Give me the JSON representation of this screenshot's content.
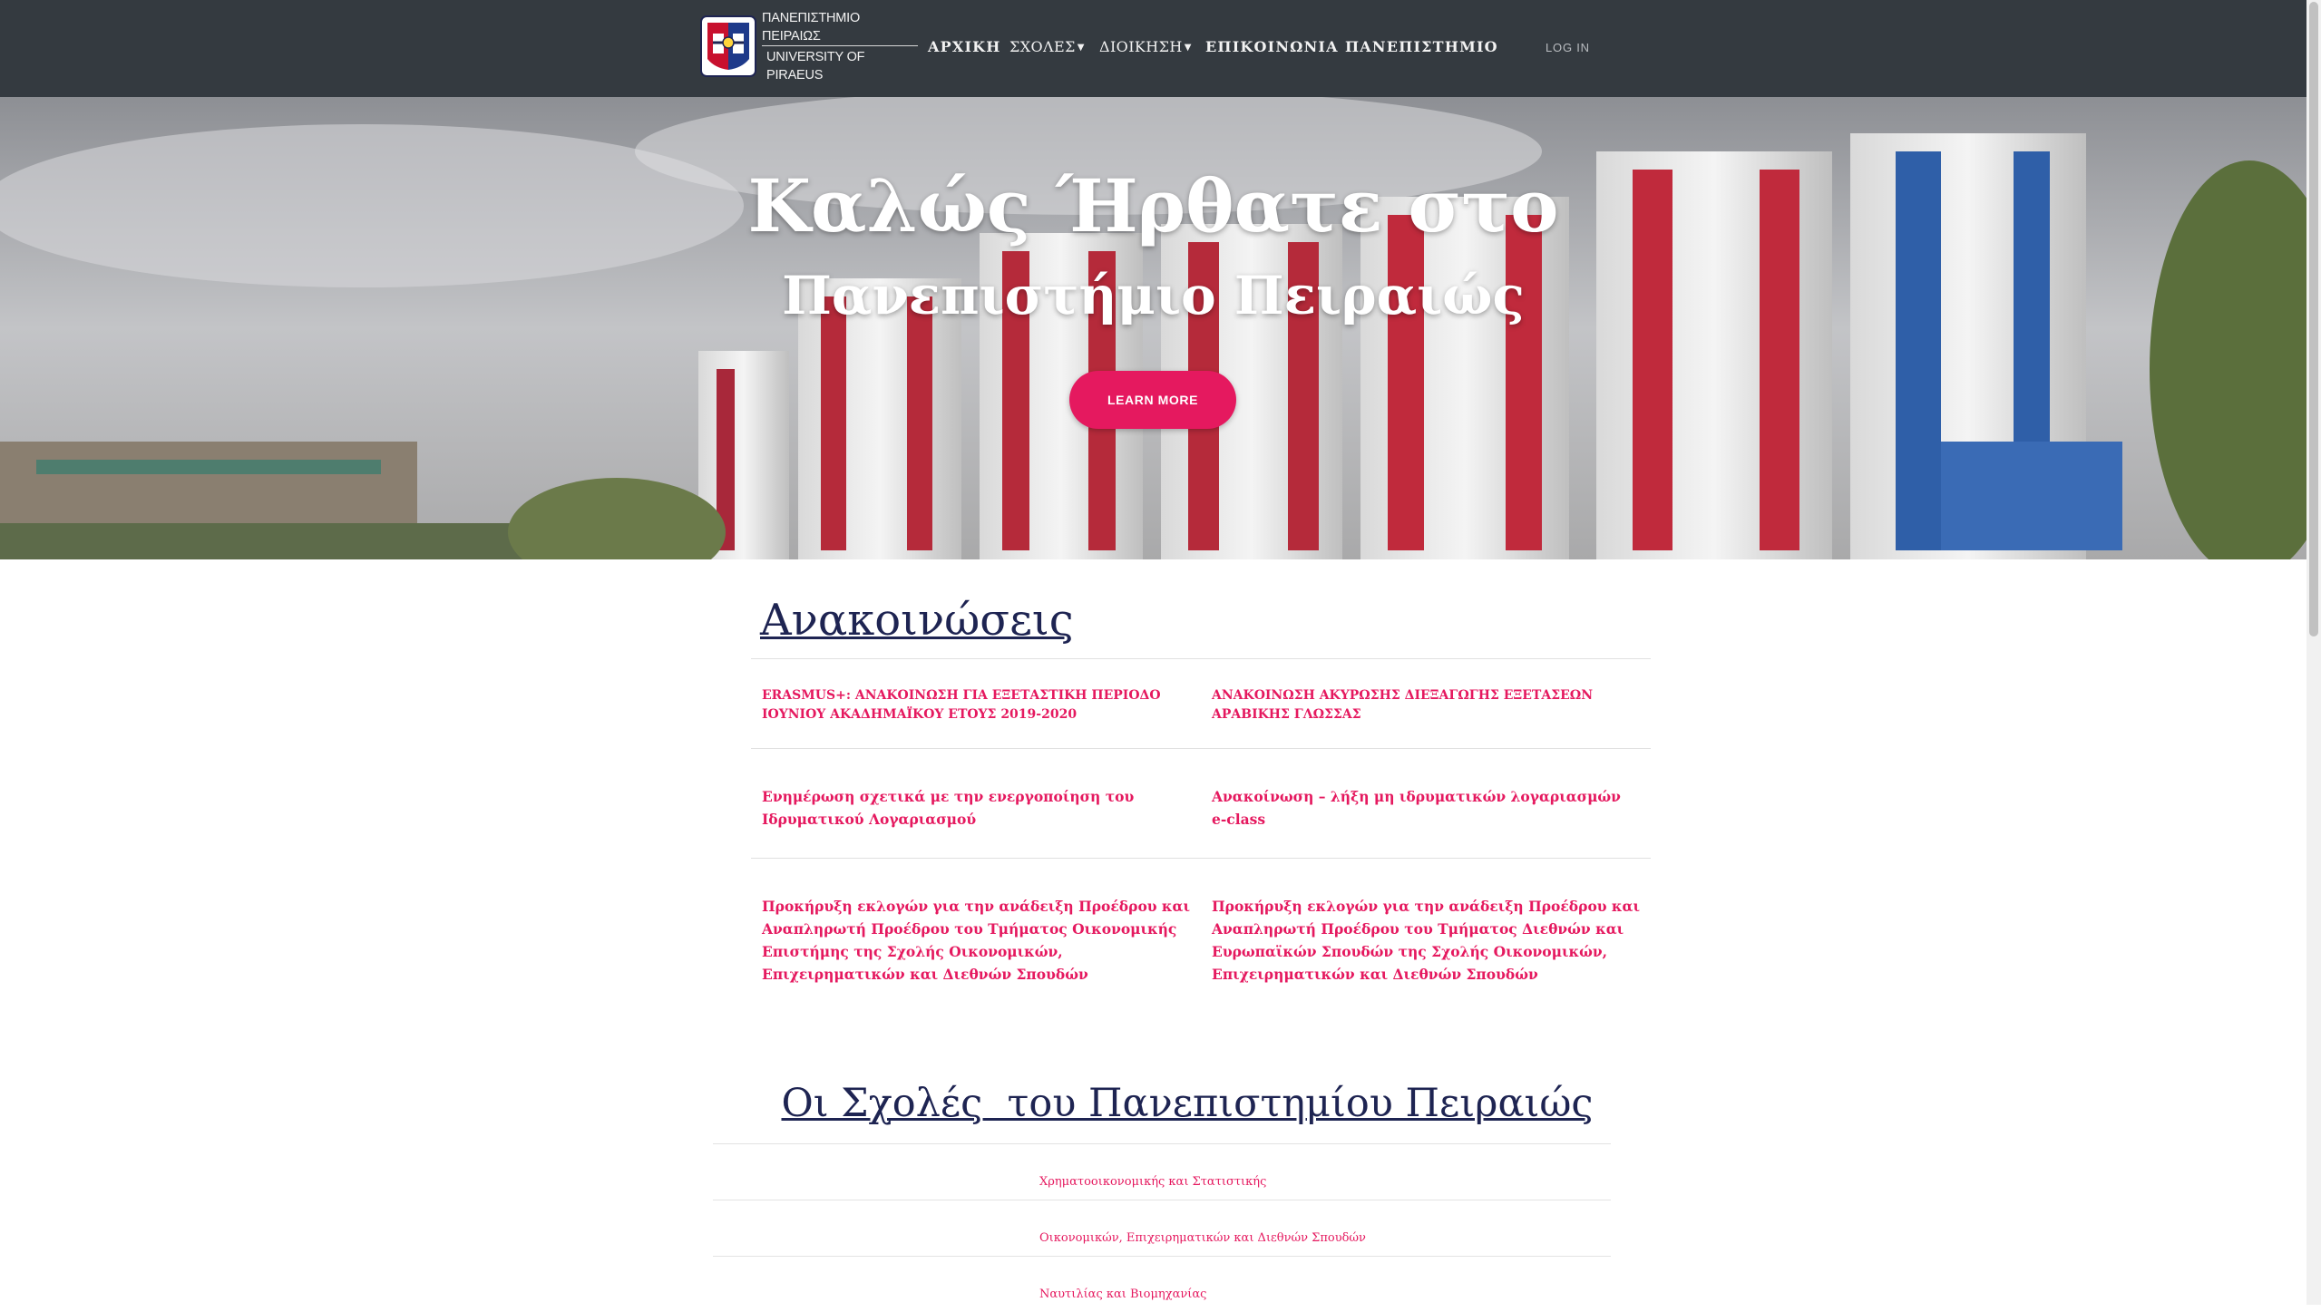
{
  "navbar": {
    "logo": {
      "line1": "ΠΑΝΕΠΙΣΤΗΜΙΟ ΠΕΙΡΑΙΩΣ",
      "line2": "UNIVERSITY OF PIRAEUS"
    },
    "items": [
      {
        "label": "ΑΡΧΙΚΗ"
      },
      {
        "label": "ΣΧΟΛΕΣ"
      },
      {
        "label": "ΔΙΟΙΚΗΣΗ"
      },
      {
        "label": "ΕΠΙΚΟΙΝΩΝΙΑ"
      },
      {
        "label": "ΠΑΝΕΠΙΣΤΗΜΙΟ"
      }
    ],
    "login": "LOG IN"
  },
  "hero": {
    "title_line1": "Καλώς Ήρθατε στο",
    "title_line2": "Πανεπιστήμιο Πειραιώς",
    "button_label": "LEARN MORE"
  },
  "announcements": {
    "title": "Ανακοινώσεις",
    "items": [
      "ERASMUS+: ΑΝΑΚΟΙΝΩΣΗ ΓΙΑ ΕΞΕΤΑΣΤΙΚΗ ΠΕΡΙΟΔΟ ΙΟΥΝΙΟΥ ΑΚΑΔΗΜΑΪΚΟΥ ΕΤΟΥΣ 2019-2020",
      "ΑΝΑΚΟΙΝΩΣΗ ΑΚΥΡΩΣΗΣ ΔΙΕΞΑΓΩΓΗΣ ΕΞΕΤΑΣΕΩΝ ΑΡΑΒΙΚΗΣ ΓΛΩΣΣΑΣ",
      "Ενημέρωση σχετικά με την ενεργοποίηση του Ιδρυματικού Λογαριασμού",
      "Ανακοίνωση – λήξη μη ιδρυματικών λογαριασμών e-class",
      "Προκήρυξη εκλογών για την ανάδειξη Προέδρου και Αναπληρωτή Προέδρου του Τμήματος Οικονομικής Επιστήμης της Σχολής Οικονομικών, Επιχειρηματικών και Διεθνών Σπουδών",
      "Προκήρυξη εκλογών για την ανάδειξη Προέδρου και Αναπληρωτή Προέδρου του Τμήματος Διεθνών και Ευρωπαϊκών Σπουδών της Σχολής Οικονομικών, Επιχειρηματικών και Διεθνών Σπουδών"
    ]
  },
  "schools": {
    "title": "Οι Σχολές  του Πανεπιστημίου Πειραιώς",
    "items": [
      "Χρηματοοικονομικής και Στατιστικής",
      "Οικονομικών, Επιχειρηματικών και Διεθνών Σπουδών",
      "Ναυτιλίας και Βιομηχανίας"
    ]
  },
  "colors": {
    "navbar_bg": "#343a40",
    "accent_pink": "#e5195f",
    "heading_navy": "#1e2452"
  }
}
